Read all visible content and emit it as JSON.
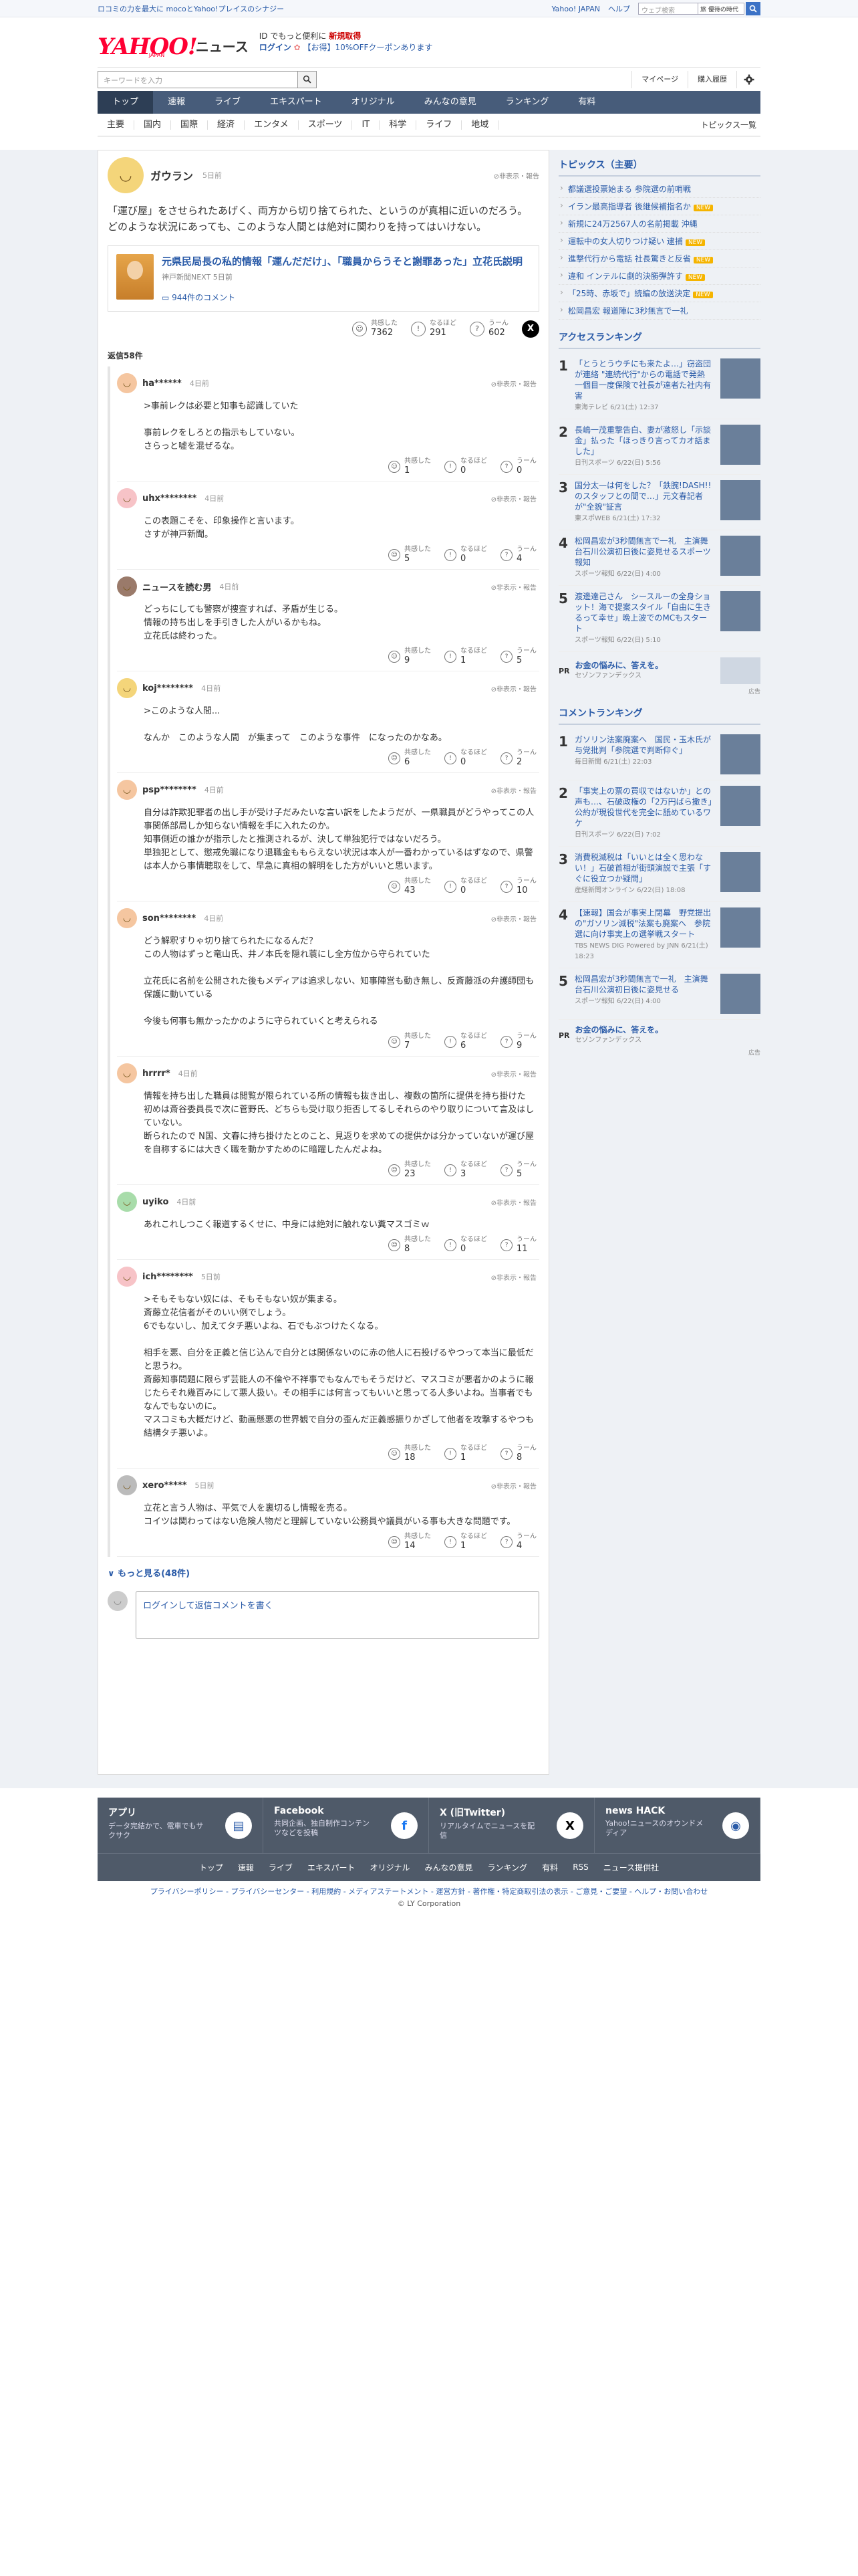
{
  "topbar": {
    "promo": "ロコミの力を最大に mocoとYahoo!プレイスのシナジー",
    "links": [
      "Yahoo! JAPAN",
      "ヘルプ"
    ],
    "search_placeholder": "ウェブ検索",
    "search_value2": "旅 優待の時代"
  },
  "header": {
    "logo": "YAHOO!",
    "logo_sub": "JAPAN",
    "service": "ニュース",
    "line1_pre": "ID でもっと便利に",
    "line1_link": "新規取得",
    "line2_login": "ログイン",
    "line2_promo": "【お得】10%OFFクーポンあります"
  },
  "search": {
    "placeholder": "キーワードを入力",
    "mypage": "マイページ",
    "history": "購入履歴"
  },
  "nav": {
    "items": [
      "トップ",
      "速報",
      "ライブ",
      "エキスパート",
      "オリジナル",
      "みんなの意見",
      "ランキング",
      "有料"
    ]
  },
  "subnav": {
    "items": [
      "主要",
      "国内",
      "国際",
      "経済",
      "エンタメ",
      "スポーツ",
      "IT",
      "科学",
      "ライフ",
      "地域"
    ],
    "topics_all": "トピックス一覧"
  },
  "comment": {
    "user": "ガウラン",
    "time": "5日前",
    "report": "非表示・報告",
    "text": "「運び屋」をさせられたあげく、両方から切り捨てられた、というのが真相に近いのだろう。\nどのような状況にあっても、このような人間とは絶対に関わりを持ってはいけない。",
    "article_title": "元県民局長の私的情報「運んだだけ」、「職員からうそと謝罪あった」立花氏説明",
    "article_src": "神戸新聞NEXT 5日前",
    "article_comments": "944件のコメント",
    "r_label1": "共感した",
    "r_label2": "なるほど",
    "r_label3": "うーん",
    "r_num1": "7362",
    "r_num2": "291",
    "r_num3": "602"
  },
  "replies_count": "返信58件",
  "replies": [
    {
      "user": "ha******",
      "time": "4日前",
      "color": "#f5c6a0",
      "text": ">事前レクは必要と知事も認識していた\n\n事前レクをしろとの指示もしていない。\nさらっと嘘を混ぜるな。",
      "n1": "1",
      "n2": "0",
      "n3": "0"
    },
    {
      "user": "uhx********",
      "time": "4日前",
      "color": "#f7c3c7",
      "text": "この表題こそを、印象操作と言います。\nさすが神戸新聞。",
      "n1": "5",
      "n2": "0",
      "n3": "4"
    },
    {
      "user": "ニュースを読む男",
      "time": "4日前",
      "color": "#9a7a6a",
      "text": "どっちにしても警察が捜査すれば、矛盾が生じる。\n情報の持ち出しを手引きした人がいるかもね。\n立花氏は終わった。",
      "n1": "9",
      "n2": "1",
      "n3": "5"
    },
    {
      "user": "koj********",
      "time": "4日前",
      "color": "#f4d57a",
      "text": ">このような人間...\n\nなんか　このような人間　が集まって　このような事件　になったのかなあ。",
      "n1": "6",
      "n2": "0",
      "n3": "2"
    },
    {
      "user": "psp********",
      "time": "4日前",
      "color": "#f5c6a0",
      "text": "自分は詐欺犯罪者の出し手が受け子だみたいな言い訳をしたようだが、一県職員がどうやってこの人事関係部局しか知らない情報を手に入れたのか。\n知事側近の誰かが指示したと推測されるが、決して単独犯行ではないだろう。\n単独犯として、懲戒免職になり退職金ももらえない状況は本人が一番わかっているはずなので、県警は本人から事情聴取をして、早急に真相の解明をした方がいいと思います。",
      "n1": "43",
      "n2": "0",
      "n3": "10"
    },
    {
      "user": "son********",
      "time": "4日前",
      "color": "#f5c6a0",
      "text": "どう解釈すりゃ切り捨てられたになるんだ？\nこの人物はずっと竜山氏、井ノ本氏を隠れ蓑にし全方位から守られていた\n\n立花氏に名前を公開された後もメディアは追求しない、知事陣営も動き無し、反斎藤派の弁護師団も保護に動いている\n\n今後も何事も無かったかのように守られていくと考えられる",
      "n1": "7",
      "n2": "6",
      "n3": "9"
    },
    {
      "user": "hrrrr*",
      "time": "4日前",
      "color": "#f5c6a0",
      "text": "情報を持ち出した職員は閲覧が限られている所の情報も抜き出し、複数の箇所に提供を持ち掛けた\n初めは斎谷委員長で次に菅野氏、どちらも受け取り拒否してるしそれらのやり取りについて言及はしていない。\n断られたので N国、文春に持ち掛けたとのこと、見返りを求めての提供かは分かっていないが運び屋を自称するには大きく職を動かすためのに暗躍したんだよね。",
      "n1": "23",
      "n2": "3",
      "n3": "5"
    },
    {
      "user": "uyiko",
      "time": "4日前",
      "color": "#a8dcaa",
      "text": "あれこれしつこく報道するくせに、中身には絶対に触れない糞マスゴミｗ",
      "n1": "8",
      "n2": "0",
      "n3": "11"
    },
    {
      "user": "ich********",
      "time": "5日前",
      "color": "#f7c3c7",
      "text": ">そもそもない奴には、そもそもない奴が集まる。\n斎藤立花信者がそのいい例でしょう。\n6でもないし、加えてタチ悪いよね、石でもぶつけたくなる。\n\n相手を悪、自分を正義と信じ込んで自分とは関係ないのに赤の他人に石投げるやつって本当に最低だと思うわ。\n斎藤知事問題に限らず芸能人の不倫や不祥事でもなんでもそうだけど、マスコミが悪者かのように報じたらそれ幾百みにして悪人扱い。その相手には何言ってもいいと思ってる人多いよね。当事者でもなんでもないのに。\nマスコミも大概だけど、動画懸悪の世界観で自分の歪んだ正義感振りかざして他者を攻撃するやつも結構タチ悪いよ。",
      "n1": "18",
      "n2": "1",
      "n3": "8"
    },
    {
      "user": "xero*****",
      "time": "5日前",
      "color": "#bbbbbb",
      "text": "立花と言う人物は、平気で人を裏切るし情報を売る。\nコイツは関わってはない危険人物だと理解していない公務員や議員がいる事も大きな問題です。",
      "n1": "14",
      "n2": "1",
      "n3": "4"
    }
  ],
  "more": "もっと見る(48件)",
  "reply_placeholder": "ログインして返信コメントを書く",
  "side": {
    "topics_title": "トピックス（主要）",
    "topics": [
      {
        "t": "都議選投票始まる 参院選の前哨戦",
        "new": ""
      },
      {
        "t": "イラン最高指導者 後継候補指名か",
        "new": "NEW"
      },
      {
        "t": "新規に24万2567人の名前掲載 沖縄",
        "new": ""
      },
      {
        "t": "運転中の女人切りつけ疑い 逮捕",
        "new": "NEW"
      },
      {
        "t": "進撃代行から電話 社長驚きと反省",
        "new": "NEW"
      },
      {
        "t": "違和 インテルに劇的決勝弾許す",
        "new": "NEW"
      },
      {
        "t": "「25時、赤坂で」続編の放送決定",
        "new": "NEW"
      },
      {
        "t": "松岡昌宏 報道陣に3秒無言で一礼",
        "new": ""
      }
    ],
    "access_title": "アクセスランキング",
    "access": [
      {
        "t": "「とうとうウチにも来たよ…」窃盗団が連絡 \"連続代行\"からの電話で発熱 一個目一度保険で社長が達者た社内有害",
        "s": "東海テレビ 6/21(土) 12:37"
      },
      {
        "t": "長嶋一茂重撃告白、妻が激怒し「示談金」払った「ほっきり言ってカオ話ました」",
        "s": "日刊スポーツ 6/22(日) 5:56"
      },
      {
        "t": "国分太一は何をした？「鉄腕!DASH!!のスタッフとの間で…」元文春記者が\"全貌\"証言",
        "s": "東スポWEB 6/21(土) 17:32"
      },
      {
        "t": "松岡昌宏が3秒間無言で一礼　主演舞台石川公演初日後に姿見せるスポーツ報知",
        "s": "スポーツ報知 6/22(日) 4:00"
      },
      {
        "t": "渡邊達己さん　シースルーの全身ショット！海で提案スタイル「自由に生きるって幸せ」晩上波でのMCもスタート",
        "s": "スポーツ報知 6/22(日) 5:10"
      }
    ],
    "pr1": {
      "tag": "PR",
      "t": "お金の悩みに、答えを。",
      "s": "セゾンファンデックス"
    },
    "adinfo": "広告",
    "comment_title": "コメントランキング",
    "comment_rank": [
      {
        "t": "ガソリン法案廃案へ　国民・玉木氏が与党批判「参院選で判断仰ぐ」",
        "s": "毎日新聞 6/21(土) 22:03"
      },
      {
        "t": "「事実上の票の買収ではないか」との声も…、石破政権の「2万円ばら撒き」公約が現役世代を完全に舐めているワケ",
        "s": "日刊スポーツ 6/22(日) 7:02"
      },
      {
        "t": "消費税減税は「いいとは全く思わない！」石破首相が街頭演説で主張「すぐに役立つか疑問」",
        "s": "産経新聞オンライン 6/22(日) 18:08"
      },
      {
        "t": "【速報】国会が事実上閉幕　野党提出の\"ガソリン減税\"法案も廃案へ　参院選に向け事実上の選挙戦スタート",
        "s": "TBS NEWS DIG Powered by JNN 6/21(土) 18:23"
      },
      {
        "t": "松岡昌宏が3秒間無言で一礼　主演舞台石川公演初日後に姿見せる",
        "s": "スポーツ報知 6/22(日) 4:00"
      }
    ],
    "pr2": {
      "tag": "PR",
      "t": "お金の悩みに、答えを。",
      "s": "セゾンファンデックス"
    }
  },
  "footer": {
    "apps": [
      {
        "t": "アプリ",
        "d": "データ完結かで、電車でもサクサク",
        "icon": "news-app-icon"
      },
      {
        "t": "Facebook",
        "d": "共同企画、独自制作コンテンツなどを投稿",
        "icon": "facebook-icon"
      },
      {
        "t": "X (旧Twitter)",
        "d": "リアルタイムでニュースを配信",
        "icon": "x-icon"
      },
      {
        "t": "news HACK",
        "d": "Yahoo!ニュースのオウンドメディア",
        "icon": "news-hack-icon"
      }
    ],
    "links": [
      "トップ",
      "速報",
      "ライブ",
      "エキスパート",
      "オリジナル",
      "みんなの意見",
      "ランキング",
      "有料",
      "RSS",
      "ニュース提供社"
    ],
    "policy": "プライバシーポリシー - プライバシーセンター - 利用規約 - メディアステートメント - 運営方針 - 著作権・特定商取引法の表示 - ご意見・ご要望 - ヘルプ・お問い合わせ",
    "copyright": "© LY Corporation"
  },
  "colors": {
    "accent": "#2a5ba8",
    "nav": "#475c7a",
    "brand": "#ff0033"
  }
}
